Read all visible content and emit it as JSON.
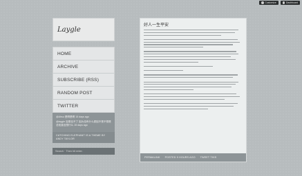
{
  "topbar": {
    "customize_label": "Customize",
    "dashboard_label": "Dashboard"
  },
  "blog": {
    "title": "Laygle"
  },
  "nav": {
    "items": [
      {
        "label": "HOME"
      },
      {
        "label": "ARCHIVE"
      },
      {
        "label": "SUBSCRIBE (RSS)"
      },
      {
        "label": "RANDOM POST"
      },
      {
        "label": "TWITTER"
      }
    ]
  },
  "feed": {
    "entries": [
      "@Ahsu 是啊是啊 15 days ago",
      "@laygle 没是没不了 因为没有什么原因不是不想是总知道没想什么 15 days ago"
    ],
    "credit": "CATCHING ELEPHANT IS A THEME BY ANDY TAYLOR"
  },
  "search": {
    "placeholder": "Search · Then hit enter."
  },
  "post": {
    "title": "好人一生平安",
    "footer": {
      "permalink": "PERMALINK",
      "posted": "POSTED 9 HOURS AGO",
      "tweet": "TWEET THIS"
    }
  }
}
